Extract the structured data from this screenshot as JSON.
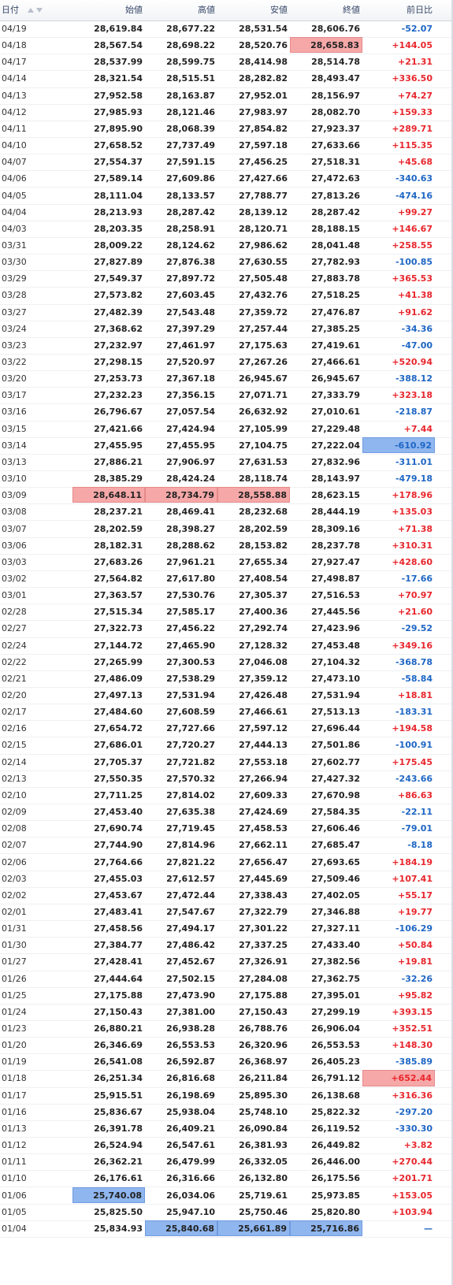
{
  "header": {
    "date": "日付",
    "open": "始値",
    "high": "高値",
    "low": "安値",
    "close": "終値",
    "change": "前日比"
  },
  "colors": {
    "up": "#e8262c",
    "down": "#1e66c4",
    "highlight_red": "#f6a8a8",
    "highlight_blue": "#8fb6ee"
  },
  "rows": [
    {
      "date": "04/19",
      "open": "28,619.84",
      "high": "28,677.22",
      "low": "28,531.54",
      "close": "28,606.76",
      "change": "-52.07",
      "dir": "down"
    },
    {
      "date": "04/18",
      "open": "28,567.54",
      "high": "28,698.22",
      "low": "28,520.76",
      "close": "28,658.83",
      "change": "+144.05",
      "dir": "up",
      "hl": {
        "close": "red"
      }
    },
    {
      "date": "04/17",
      "open": "28,537.99",
      "high": "28,599.75",
      "low": "28,414.98",
      "close": "28,514.78",
      "change": "+21.31",
      "dir": "up"
    },
    {
      "date": "04/14",
      "open": "28,321.54",
      "high": "28,515.51",
      "low": "28,282.82",
      "close": "28,493.47",
      "change": "+336.50",
      "dir": "up"
    },
    {
      "date": "04/13",
      "open": "27,952.58",
      "high": "28,163.87",
      "low": "27,952.01",
      "close": "28,156.97",
      "change": "+74.27",
      "dir": "up"
    },
    {
      "date": "04/12",
      "open": "27,985.93",
      "high": "28,121.46",
      "low": "27,983.97",
      "close": "28,082.70",
      "change": "+159.33",
      "dir": "up"
    },
    {
      "date": "04/11",
      "open": "27,895.90",
      "high": "28,068.39",
      "low": "27,854.82",
      "close": "27,923.37",
      "change": "+289.71",
      "dir": "up"
    },
    {
      "date": "04/10",
      "open": "27,658.52",
      "high": "27,737.49",
      "low": "27,597.18",
      "close": "27,633.66",
      "change": "+115.35",
      "dir": "up"
    },
    {
      "date": "04/07",
      "open": "27,554.37",
      "high": "27,591.15",
      "low": "27,456.25",
      "close": "27,518.31",
      "change": "+45.68",
      "dir": "up"
    },
    {
      "date": "04/06",
      "open": "27,589.14",
      "high": "27,609.86",
      "low": "27,427.66",
      "close": "27,472.63",
      "change": "-340.63",
      "dir": "down"
    },
    {
      "date": "04/05",
      "open": "28,111.04",
      "high": "28,133.57",
      "low": "27,788.77",
      "close": "27,813.26",
      "change": "-474.16",
      "dir": "down"
    },
    {
      "date": "04/04",
      "open": "28,213.93",
      "high": "28,287.42",
      "low": "28,139.12",
      "close": "28,287.42",
      "change": "+99.27",
      "dir": "up"
    },
    {
      "date": "04/03",
      "open": "28,203.35",
      "high": "28,258.91",
      "low": "28,120.71",
      "close": "28,188.15",
      "change": "+146.67",
      "dir": "up"
    },
    {
      "date": "03/31",
      "open": "28,009.22",
      "high": "28,124.62",
      "low": "27,986.62",
      "close": "28,041.48",
      "change": "+258.55",
      "dir": "up"
    },
    {
      "date": "03/30",
      "open": "27,827.89",
      "high": "27,876.38",
      "low": "27,630.55",
      "close": "27,782.93",
      "change": "-100.85",
      "dir": "down"
    },
    {
      "date": "03/29",
      "open": "27,549.37",
      "high": "27,897.72",
      "low": "27,505.48",
      "close": "27,883.78",
      "change": "+365.53",
      "dir": "up"
    },
    {
      "date": "03/28",
      "open": "27,573.82",
      "high": "27,603.45",
      "low": "27,432.76",
      "close": "27,518.25",
      "change": "+41.38",
      "dir": "up"
    },
    {
      "date": "03/27",
      "open": "27,482.39",
      "high": "27,543.48",
      "low": "27,359.72",
      "close": "27,476.87",
      "change": "+91.62",
      "dir": "up"
    },
    {
      "date": "03/24",
      "open": "27,368.62",
      "high": "27,397.29",
      "low": "27,257.44",
      "close": "27,385.25",
      "change": "-34.36",
      "dir": "down"
    },
    {
      "date": "03/23",
      "open": "27,232.97",
      "high": "27,461.97",
      "low": "27,175.63",
      "close": "27,419.61",
      "change": "-47.00",
      "dir": "down"
    },
    {
      "date": "03/22",
      "open": "27,298.15",
      "high": "27,520.97",
      "low": "27,267.26",
      "close": "27,466.61",
      "change": "+520.94",
      "dir": "up"
    },
    {
      "date": "03/20",
      "open": "27,253.73",
      "high": "27,367.18",
      "low": "26,945.67",
      "close": "26,945.67",
      "change": "-388.12",
      "dir": "down"
    },
    {
      "date": "03/17",
      "open": "27,232.23",
      "high": "27,356.15",
      "low": "27,071.71",
      "close": "27,333.79",
      "change": "+323.18",
      "dir": "up"
    },
    {
      "date": "03/16",
      "open": "26,796.67",
      "high": "27,057.54",
      "low": "26,632.92",
      "close": "27,010.61",
      "change": "-218.87",
      "dir": "down"
    },
    {
      "date": "03/15",
      "open": "27,421.66",
      "high": "27,424.94",
      "low": "27,105.99",
      "close": "27,229.48",
      "change": "+7.44",
      "dir": "up"
    },
    {
      "date": "03/14",
      "open": "27,455.95",
      "high": "27,455.95",
      "low": "27,104.75",
      "close": "27,222.04",
      "change": "-610.92",
      "dir": "down",
      "hl": {
        "change": "blue"
      }
    },
    {
      "date": "03/13",
      "open": "27,886.21",
      "high": "27,906.97",
      "low": "27,631.53",
      "close": "27,832.96",
      "change": "-311.01",
      "dir": "down"
    },
    {
      "date": "03/10",
      "open": "28,385.29",
      "high": "28,424.24",
      "low": "28,118.74",
      "close": "28,143.97",
      "change": "-479.18",
      "dir": "down"
    },
    {
      "date": "03/09",
      "open": "28,648.11",
      "high": "28,734.79",
      "low": "28,558.88",
      "close": "28,623.15",
      "change": "+178.96",
      "dir": "up",
      "hl": {
        "open": "red",
        "high": "red",
        "low": "red"
      }
    },
    {
      "date": "03/08",
      "open": "28,237.21",
      "high": "28,469.41",
      "low": "28,232.68",
      "close": "28,444.19",
      "change": "+135.03",
      "dir": "up"
    },
    {
      "date": "03/07",
      "open": "28,202.59",
      "high": "28,398.27",
      "low": "28,202.59",
      "close": "28,309.16",
      "change": "+71.38",
      "dir": "up"
    },
    {
      "date": "03/06",
      "open": "28,182.31",
      "high": "28,288.62",
      "low": "28,153.82",
      "close": "28,237.78",
      "change": "+310.31",
      "dir": "up"
    },
    {
      "date": "03/03",
      "open": "27,683.26",
      "high": "27,961.21",
      "low": "27,655.34",
      "close": "27,927.47",
      "change": "+428.60",
      "dir": "up"
    },
    {
      "date": "03/02",
      "open": "27,564.82",
      "high": "27,617.80",
      "low": "27,408.54",
      "close": "27,498.87",
      "change": "-17.66",
      "dir": "down"
    },
    {
      "date": "03/01",
      "open": "27,363.57",
      "high": "27,530.76",
      "low": "27,305.37",
      "close": "27,516.53",
      "change": "+70.97",
      "dir": "up"
    },
    {
      "date": "02/28",
      "open": "27,515.34",
      "high": "27,585.17",
      "low": "27,400.36",
      "close": "27,445.56",
      "change": "+21.60",
      "dir": "up"
    },
    {
      "date": "02/27",
      "open": "27,322.73",
      "high": "27,456.22",
      "low": "27,292.74",
      "close": "27,423.96",
      "change": "-29.52",
      "dir": "down"
    },
    {
      "date": "02/24",
      "open": "27,144.72",
      "high": "27,465.90",
      "low": "27,128.32",
      "close": "27,453.48",
      "change": "+349.16",
      "dir": "up"
    },
    {
      "date": "02/22",
      "open": "27,265.99",
      "high": "27,300.53",
      "low": "27,046.08",
      "close": "27,104.32",
      "change": "-368.78",
      "dir": "down"
    },
    {
      "date": "02/21",
      "open": "27,486.09",
      "high": "27,538.29",
      "low": "27,359.12",
      "close": "27,473.10",
      "change": "-58.84",
      "dir": "down"
    },
    {
      "date": "02/20",
      "open": "27,497.13",
      "high": "27,531.94",
      "low": "27,426.48",
      "close": "27,531.94",
      "change": "+18.81",
      "dir": "up"
    },
    {
      "date": "02/17",
      "open": "27,484.60",
      "high": "27,608.59",
      "low": "27,466.61",
      "close": "27,513.13",
      "change": "-183.31",
      "dir": "down"
    },
    {
      "date": "02/16",
      "open": "27,654.72",
      "high": "27,727.66",
      "low": "27,597.12",
      "close": "27,696.44",
      "change": "+194.58",
      "dir": "up"
    },
    {
      "date": "02/15",
      "open": "27,686.01",
      "high": "27,720.27",
      "low": "27,444.13",
      "close": "27,501.86",
      "change": "-100.91",
      "dir": "down"
    },
    {
      "date": "02/14",
      "open": "27,705.37",
      "high": "27,721.82",
      "low": "27,553.18",
      "close": "27,602.77",
      "change": "+175.45",
      "dir": "up"
    },
    {
      "date": "02/13",
      "open": "27,550.35",
      "high": "27,570.32",
      "low": "27,266.94",
      "close": "27,427.32",
      "change": "-243.66",
      "dir": "down"
    },
    {
      "date": "02/10",
      "open": "27,711.25",
      "high": "27,814.02",
      "low": "27,609.33",
      "close": "27,670.98",
      "change": "+86.63",
      "dir": "up"
    },
    {
      "date": "02/09",
      "open": "27,453.40",
      "high": "27,635.38",
      "low": "27,424.69",
      "close": "27,584.35",
      "change": "-22.11",
      "dir": "down"
    },
    {
      "date": "02/08",
      "open": "27,690.74",
      "high": "27,719.45",
      "low": "27,458.53",
      "close": "27,606.46",
      "change": "-79.01",
      "dir": "down"
    },
    {
      "date": "02/07",
      "open": "27,744.90",
      "high": "27,814.96",
      "low": "27,662.11",
      "close": "27,685.47",
      "change": "-8.18",
      "dir": "down"
    },
    {
      "date": "02/06",
      "open": "27,764.66",
      "high": "27,821.22",
      "low": "27,656.47",
      "close": "27,693.65",
      "change": "+184.19",
      "dir": "up"
    },
    {
      "date": "02/03",
      "open": "27,455.03",
      "high": "27,612.57",
      "low": "27,445.69",
      "close": "27,509.46",
      "change": "+107.41",
      "dir": "up"
    },
    {
      "date": "02/02",
      "open": "27,453.67",
      "high": "27,472.44",
      "low": "27,338.43",
      "close": "27,402.05",
      "change": "+55.17",
      "dir": "up"
    },
    {
      "date": "02/01",
      "open": "27,483.41",
      "high": "27,547.67",
      "low": "27,322.79",
      "close": "27,346.88",
      "change": "+19.77",
      "dir": "up"
    },
    {
      "date": "01/31",
      "open": "27,458.56",
      "high": "27,494.17",
      "low": "27,301.22",
      "close": "27,327.11",
      "change": "-106.29",
      "dir": "down"
    },
    {
      "date": "01/30",
      "open": "27,384.77",
      "high": "27,486.42",
      "low": "27,337.25",
      "close": "27,433.40",
      "change": "+50.84",
      "dir": "up"
    },
    {
      "date": "01/27",
      "open": "27,428.41",
      "high": "27,452.67",
      "low": "27,326.91",
      "close": "27,382.56",
      "change": "+19.81",
      "dir": "up"
    },
    {
      "date": "01/26",
      "open": "27,444.64",
      "high": "27,502.15",
      "low": "27,284.08",
      "close": "27,362.75",
      "change": "-32.26",
      "dir": "down"
    },
    {
      "date": "01/25",
      "open": "27,175.88",
      "high": "27,473.90",
      "low": "27,175.88",
      "close": "27,395.01",
      "change": "+95.82",
      "dir": "up"
    },
    {
      "date": "01/24",
      "open": "27,150.43",
      "high": "27,381.00",
      "low": "27,150.43",
      "close": "27,299.19",
      "change": "+393.15",
      "dir": "up"
    },
    {
      "date": "01/23",
      "open": "26,880.21",
      "high": "26,938.28",
      "low": "26,788.76",
      "close": "26,906.04",
      "change": "+352.51",
      "dir": "up"
    },
    {
      "date": "01/20",
      "open": "26,346.69",
      "high": "26,553.53",
      "low": "26,320.96",
      "close": "26,553.53",
      "change": "+148.30",
      "dir": "up"
    },
    {
      "date": "01/19",
      "open": "26,541.08",
      "high": "26,592.87",
      "low": "26,368.97",
      "close": "26,405.23",
      "change": "-385.89",
      "dir": "down"
    },
    {
      "date": "01/18",
      "open": "26,251.34",
      "high": "26,816.68",
      "low": "26,211.84",
      "close": "26,791.12",
      "change": "+652.44",
      "dir": "up",
      "hl": {
        "change": "red"
      }
    },
    {
      "date": "01/17",
      "open": "25,915.51",
      "high": "26,198.69",
      "low": "25,895.30",
      "close": "26,138.68",
      "change": "+316.36",
      "dir": "up"
    },
    {
      "date": "01/16",
      "open": "25,836.67",
      "high": "25,938.04",
      "low": "25,748.10",
      "close": "25,822.32",
      "change": "-297.20",
      "dir": "down"
    },
    {
      "date": "01/13",
      "open": "26,391.78",
      "high": "26,409.21",
      "low": "26,090.84",
      "close": "26,119.52",
      "change": "-330.30",
      "dir": "down"
    },
    {
      "date": "01/12",
      "open": "26,524.94",
      "high": "26,547.61",
      "low": "26,381.93",
      "close": "26,449.82",
      "change": "+3.82",
      "dir": "up"
    },
    {
      "date": "01/11",
      "open": "26,362.21",
      "high": "26,479.99",
      "low": "26,332.05",
      "close": "26,446.00",
      "change": "+270.44",
      "dir": "up"
    },
    {
      "date": "01/10",
      "open": "26,176.61",
      "high": "26,316.66",
      "low": "26,132.80",
      "close": "26,175.56",
      "change": "+201.71",
      "dir": "up"
    },
    {
      "date": "01/06",
      "open": "25,740.08",
      "high": "26,034.06",
      "low": "25,719.61",
      "close": "25,973.85",
      "change": "+153.05",
      "dir": "up",
      "hl": {
        "open": "blue"
      }
    },
    {
      "date": "01/05",
      "open": "25,825.50",
      "high": "25,947.10",
      "low": "25,750.46",
      "close": "25,820.80",
      "change": "+103.94",
      "dir": "up"
    },
    {
      "date": "01/04",
      "open": "25,834.93",
      "high": "25,840.68",
      "low": "25,661.89",
      "close": "25,716.86",
      "change": "—",
      "dir": "flat",
      "hl": {
        "high": "blue",
        "low": "blue",
        "close": "blue"
      }
    }
  ]
}
